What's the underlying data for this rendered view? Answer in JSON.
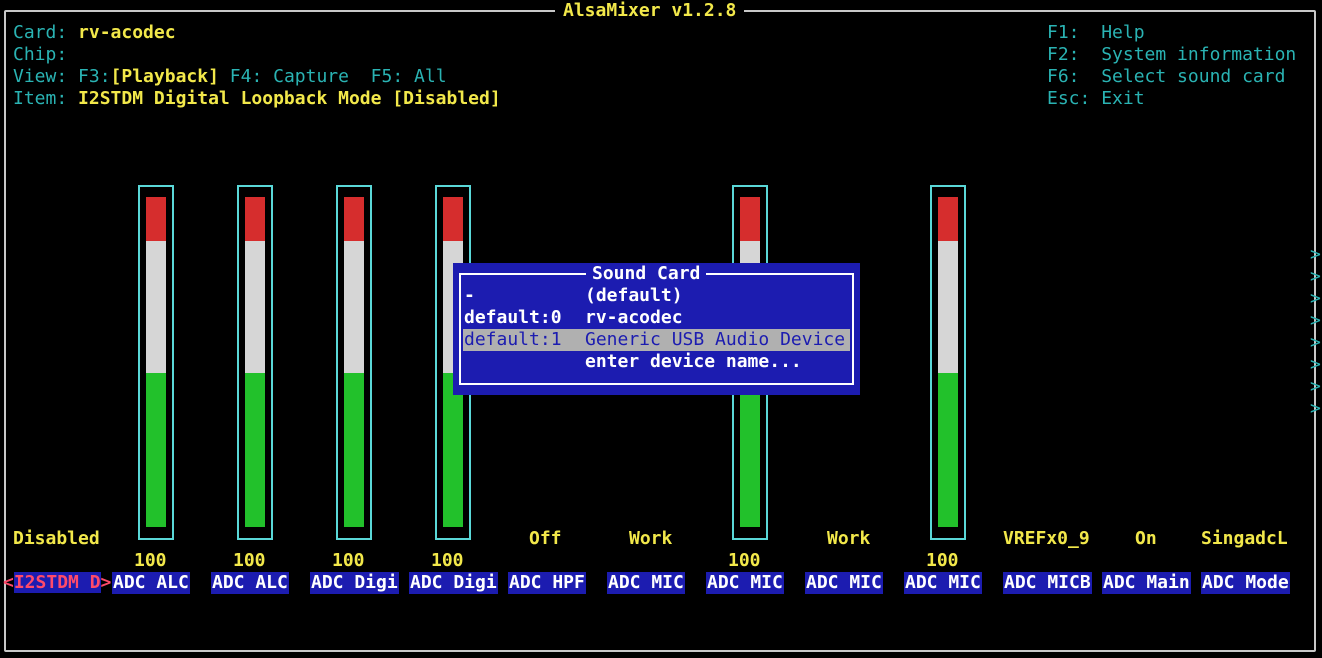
{
  "app": {
    "title": "AlsaMixer v1.2.8"
  },
  "info": {
    "card_label": "Card:",
    "card_value": "rv-acodec",
    "chip_label": "Chip:",
    "chip_value": "",
    "view_label": "View:",
    "view_f3_key": "F3:",
    "view_f3": "[Playback]",
    "view_f4": "F4: Capture",
    "view_f5": "F5: All",
    "item_label": "Item:",
    "item_value": "I2STDM Digital Loopback Mode [Disabled]"
  },
  "help": [
    {
      "key": "F1:",
      "text": "Help"
    },
    {
      "key": "F2:",
      "text": "System information"
    },
    {
      "key": "F6:",
      "text": "Select sound card"
    },
    {
      "key": "Esc:",
      "text": "Exit"
    }
  ],
  "controls": [
    {
      "name": "I2STDM D",
      "status": "Disabled",
      "value": "",
      "selected": true
    },
    {
      "name": "ADC ALC",
      "status": "",
      "value": "100",
      "level": 100
    },
    {
      "name": "ADC ALC",
      "status": "",
      "value": "100",
      "level": 100
    },
    {
      "name": "ADC Digi",
      "status": "",
      "value": "100",
      "level": 100
    },
    {
      "name": "ADC Digi",
      "status": "",
      "value": "100",
      "level": 100
    },
    {
      "name": "ADC HPF",
      "status": "Off",
      "value": ""
    },
    {
      "name": "ADC MIC",
      "status": "Work",
      "value": ""
    },
    {
      "name": "ADC MIC",
      "status": "",
      "value": "100",
      "level": 100
    },
    {
      "name": "ADC MIC",
      "status": "Work",
      "value": ""
    },
    {
      "name": "ADC MIC",
      "status": "",
      "value": "100",
      "level": 100
    },
    {
      "name": "ADC MICB",
      "status": "VREFx0_9",
      "value": ""
    },
    {
      "name": "ADC Main",
      "status": "On",
      "value": ""
    },
    {
      "name": "ADC Mode",
      "status": "SingadcL",
      "value": ""
    }
  ],
  "selector_arrows": {
    "left": "<",
    "right": ">"
  },
  "scroll_indicator": ">",
  "sound_card_dialog": {
    "title": "Sound Card",
    "items": [
      {
        "device": "-",
        "name": "(default)"
      },
      {
        "device": "default:0",
        "name": "rv-acodec"
      },
      {
        "device": "default:1",
        "name": "Generic USB Audio Device",
        "highlighted": true
      },
      {
        "device": "",
        "name": "enter device name..."
      }
    ]
  },
  "colors": {
    "background": "#000000",
    "label": "#2ab3b3",
    "value": "#f2e84a",
    "control_bg": "#1c1cb0",
    "selected_fg": "#ff4a6a",
    "dialog_bg": "#1c1cb0",
    "meter_red": "#d62d2d",
    "meter_white": "#d6d6d6",
    "meter_green": "#22c12b"
  }
}
